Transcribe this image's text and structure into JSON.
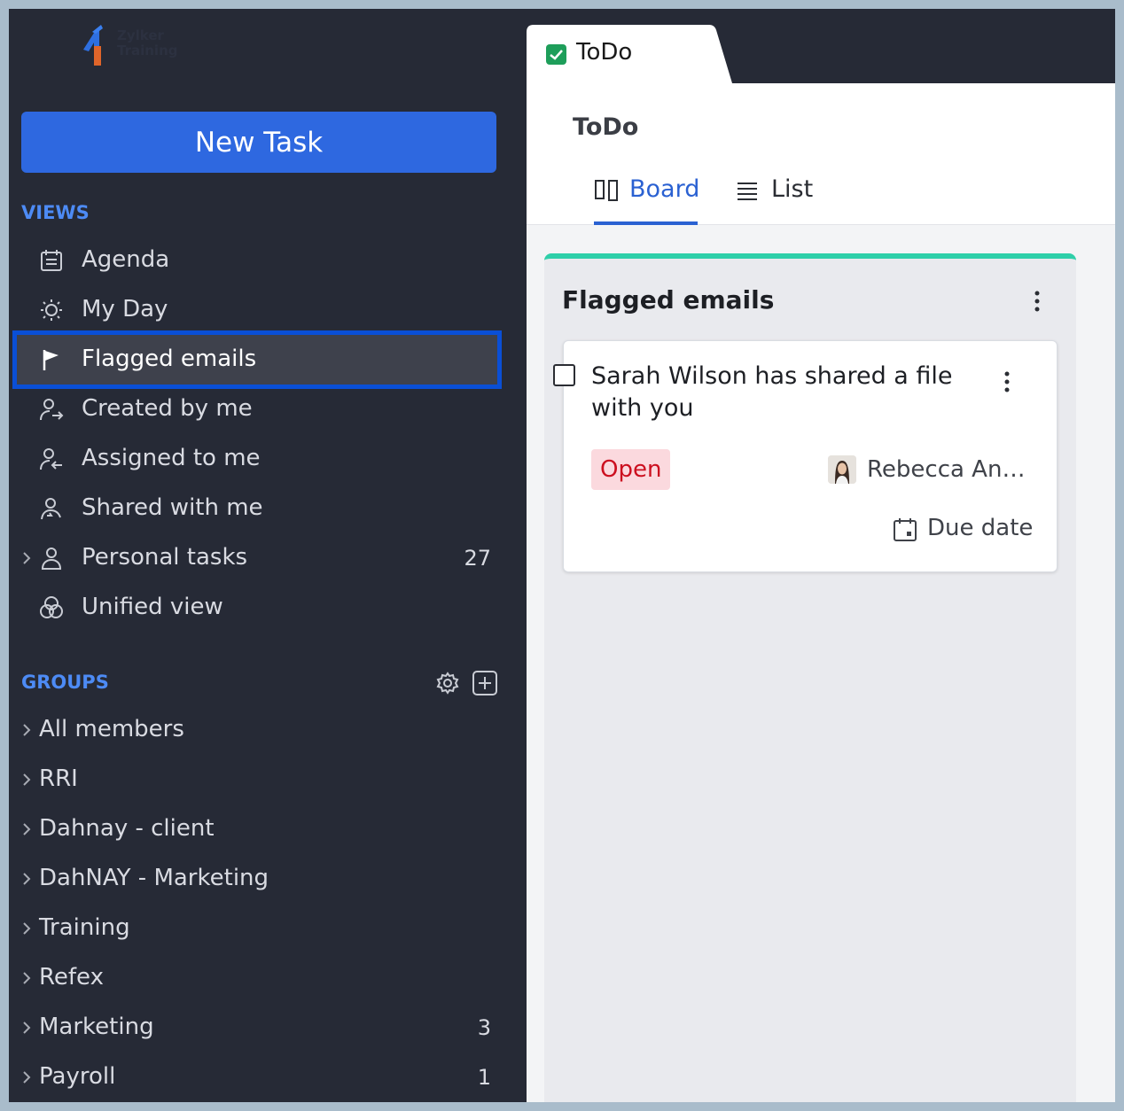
{
  "brand": {
    "logo_text_line1": "Zylker",
    "logo_text_line2": "Training"
  },
  "sidebar": {
    "new_task_label": "New Task",
    "views_label": "VIEWS",
    "views": [
      {
        "label": "Agenda",
        "icon": "calendar-list-icon"
      },
      {
        "label": "My Day",
        "icon": "sun-icon"
      },
      {
        "label": "Flagged emails",
        "icon": "flag-icon",
        "selected": true
      },
      {
        "label": "Created by me",
        "icon": "user-arrow-out-icon"
      },
      {
        "label": "Assigned to me",
        "icon": "user-arrow-in-icon"
      },
      {
        "label": "Shared with me",
        "icon": "user-share-icon"
      },
      {
        "label": "Personal tasks",
        "icon": "user-icon",
        "count": "27",
        "expandable": true
      },
      {
        "label": "Unified view",
        "icon": "venn-icon"
      }
    ],
    "groups_label": "GROUPS",
    "groups": [
      {
        "label": "All members"
      },
      {
        "label": "RRI"
      },
      {
        "label": "Dahnay - client"
      },
      {
        "label": "DahNAY - Marketing"
      },
      {
        "label": "Training"
      },
      {
        "label": "Refex"
      },
      {
        "label": "Marketing",
        "count": "3"
      },
      {
        "label": "Payroll",
        "count": "1"
      }
    ]
  },
  "tabbar": {
    "tab_label": "ToDo"
  },
  "main": {
    "title": "ToDo",
    "view_tabs": [
      {
        "label": "Board",
        "active": true
      },
      {
        "label": "List"
      }
    ],
    "column": {
      "title": "Flagged emails",
      "accent_color": "#2ecfa9",
      "cards": [
        {
          "title": "Sarah Wilson has shared a file with you",
          "status": "Open",
          "assignee": "Rebecca An…",
          "due_label": "Due date"
        }
      ]
    }
  },
  "colors": {
    "accent": "#2e68e0",
    "sidebar_bg": "#262a36",
    "selected_outline": "#0a4fd6",
    "status_open_text": "#cc1020"
  }
}
